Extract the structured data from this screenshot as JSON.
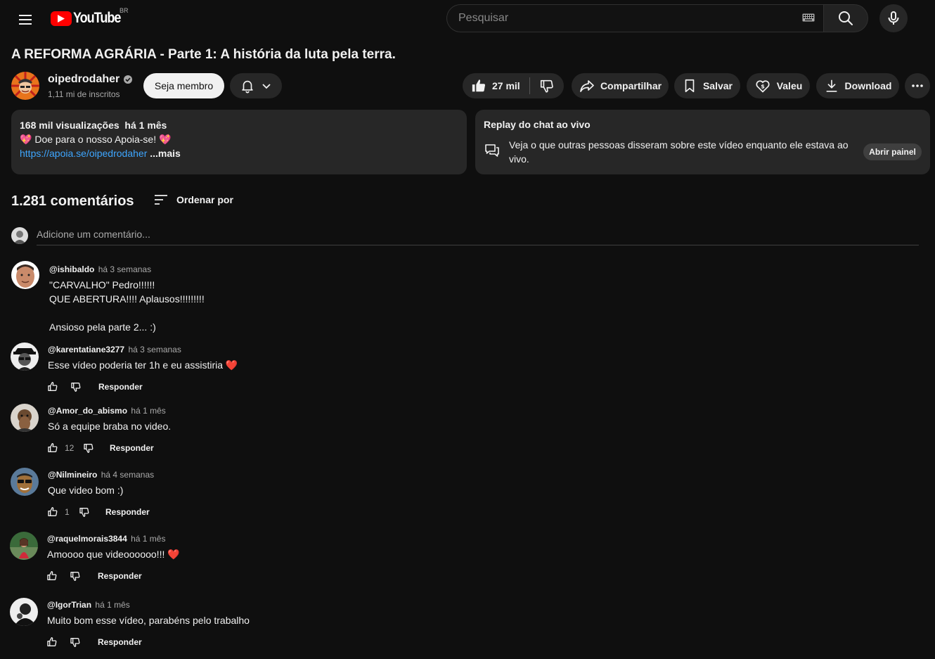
{
  "header": {
    "logo_text": "YouTube",
    "country_code": "BR",
    "search_placeholder": "Pesquisar"
  },
  "video": {
    "title": "A REFORMA AGRÁRIA - Parte 1: A história da luta pela terra."
  },
  "channel": {
    "name": "oipedrodaher",
    "subscribers": "1,11 mi de inscritos",
    "member_label": "Seja membro"
  },
  "actions": {
    "likes": "27 mil",
    "share": "Compartilhar",
    "save": "Salvar",
    "thanks": "Valeu",
    "download": "Download"
  },
  "description": {
    "views": "168 mil visualizações",
    "date": "há 1 mês",
    "line1": "Doe para o nosso Apoia-se!",
    "link": "https://apoia.se/oipedrodaher",
    "more": "...mais"
  },
  "chat_replay": {
    "title": "Replay do chat ao vivo",
    "text": "Veja o que outras pessoas disseram sobre este vídeo enquanto ele estava ao vivo.",
    "open_panel": "Abrir painel"
  },
  "comments": {
    "count": "1.281 comentários",
    "sort_label": "Ordenar por",
    "add_placeholder": "Adicione um comentário...",
    "reply_label": "Responder",
    "items": [
      {
        "author": "@ishibaldo",
        "time": "há 3 semanas",
        "text": "\"CARVALHO\" Pedro!!!!!!\nQUE ABERTURA!!!! Aplausos!!!!!!!!!\n\nAnsioso pela parte 2... :)",
        "likes": ""
      },
      {
        "author": "@karentatiane3277",
        "time": "há 3 semanas",
        "text": "Esse vídeo poderia ter 1h e eu assistiria",
        "likes": ""
      },
      {
        "author": "@Amor_do_abismo",
        "time": "há 1 mês",
        "text": "Só a equipe braba no video.",
        "likes": "12"
      },
      {
        "author": "@Nilmineiro",
        "time": "há 4 semanas",
        "text": "Que video bom :)",
        "likes": "1"
      },
      {
        "author": "@raquelmorais3844",
        "time": "há 1 mês",
        "text": "Amoooo que videoooooo!!!",
        "likes": ""
      },
      {
        "author": "@IgorTrian",
        "time": "há 1 mês",
        "text": "Muito bom esse vídeo, parabéns pelo trabalho",
        "likes": ""
      }
    ]
  },
  "colors": {
    "background": "#0f0f0f",
    "surface": "#272727",
    "brand_red": "#ff0000",
    "link_blue": "#3ea6ff",
    "heart_red": "#e8293a"
  }
}
